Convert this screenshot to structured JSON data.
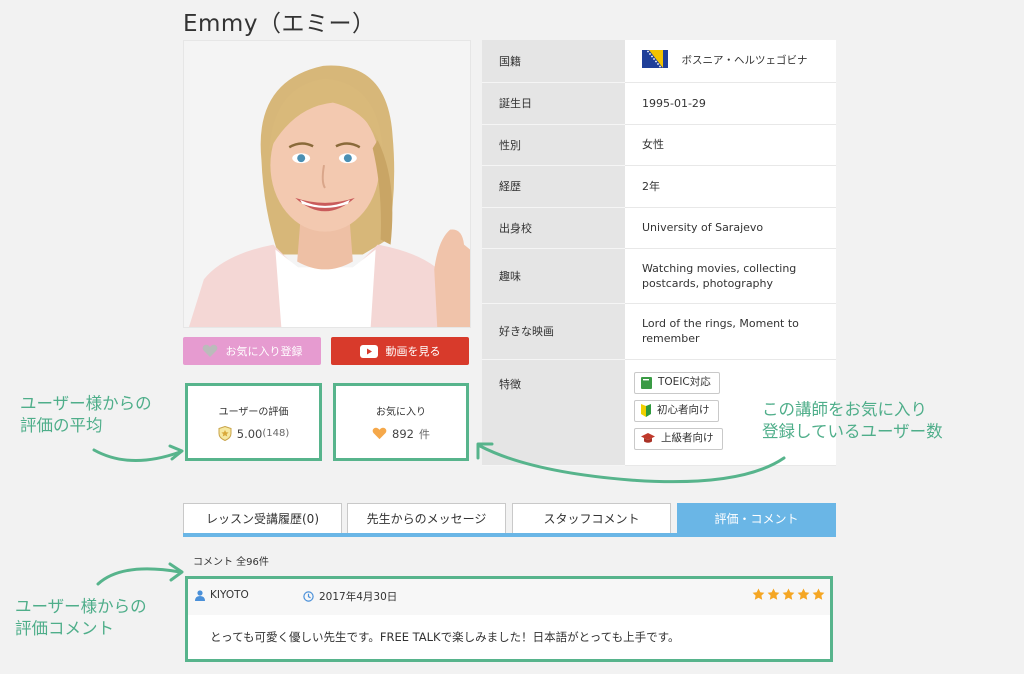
{
  "teacher": {
    "name": "Emmy（エミー）"
  },
  "buttons": {
    "favorite": "お気に入り登録",
    "video": "動画を見る"
  },
  "stats": {
    "rating_title": "ユーザーの評価",
    "rating_value": "5.00",
    "rating_count": "(148)",
    "fav_title": "お気に入り",
    "fav_value": "892",
    "fav_unit": "件"
  },
  "profile": {
    "rows": [
      {
        "key": "国籍",
        "value": "ボスニア・ヘルツェゴビナ"
      },
      {
        "key": "誕生日",
        "value": "1995-01-29"
      },
      {
        "key": "性別",
        "value": "女性"
      },
      {
        "key": "経歴",
        "value": "2年"
      },
      {
        "key": "出身校",
        "value": "University of Sarajevo"
      },
      {
        "key": "趣味",
        "value": "Watching movies, collecting postcards, photography"
      },
      {
        "key": "好きな映画",
        "value": "Lord of the rings, Moment to remember"
      },
      {
        "key": "特徴",
        "value": ""
      }
    ],
    "tags": [
      "TOEIC対応",
      "初心者向け",
      "上級者向け"
    ]
  },
  "tabs": [
    "レッスン受講履歴(0)",
    "先生からのメッセージ",
    "スタッフコメント",
    "評価・コメント"
  ],
  "comments": {
    "count_label": "コメント 全96件",
    "items": [
      {
        "user": "KIYOTO",
        "date": "2017年4月30日",
        "stars": 5,
        "text": "とっても可愛く優しい先生です。FREE TALKで楽しみました！日本語がとっても上手です。"
      }
    ]
  },
  "annotations": {
    "rating_line1": "ユーザー様からの",
    "rating_line2": "評価の平均",
    "fav_line1": "この講師をお気に入り",
    "fav_line2": "登録しているユーザー数",
    "comment_line1": "ユーザー様からの",
    "comment_line2": "評価コメント"
  },
  "colors": {
    "accent_green": "#57b48c",
    "tab_blue": "#6ab6e6",
    "fav_pink": "#e69bd0",
    "video_red": "#d83a2b",
    "star": "#f5a623"
  }
}
